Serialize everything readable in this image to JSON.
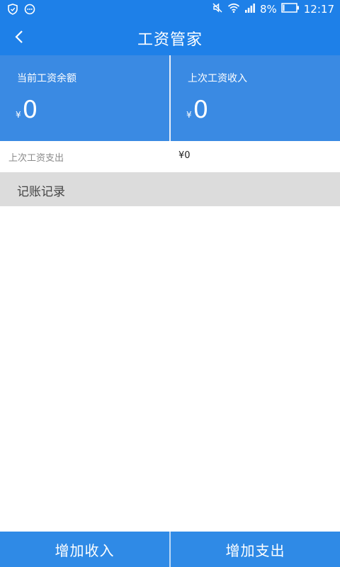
{
  "status_bar": {
    "battery": "8%",
    "time": "12:17"
  },
  "app_bar": {
    "title": "工资管家"
  },
  "cards": [
    {
      "label": "当前工资余额",
      "currency": "¥",
      "amount": "0"
    },
    {
      "label": "上次工资收入",
      "currency": "¥",
      "amount": "0"
    }
  ],
  "last_expense": {
    "label": "上次工资支出",
    "value": "¥0"
  },
  "records": {
    "title": "记账记录"
  },
  "bottom": {
    "add_income": "增加收入",
    "add_expense": "增加支出"
  },
  "colors": {
    "primary": "#1e80e8",
    "card": "#3a8ae3",
    "section_bg": "#dcdcdc",
    "button": "#2f8ae6"
  },
  "icons": [
    "shield-icon",
    "chat-icon",
    "mute-icon",
    "wifi-icon",
    "signal-icon",
    "battery-icon",
    "back-arrow-icon"
  ]
}
